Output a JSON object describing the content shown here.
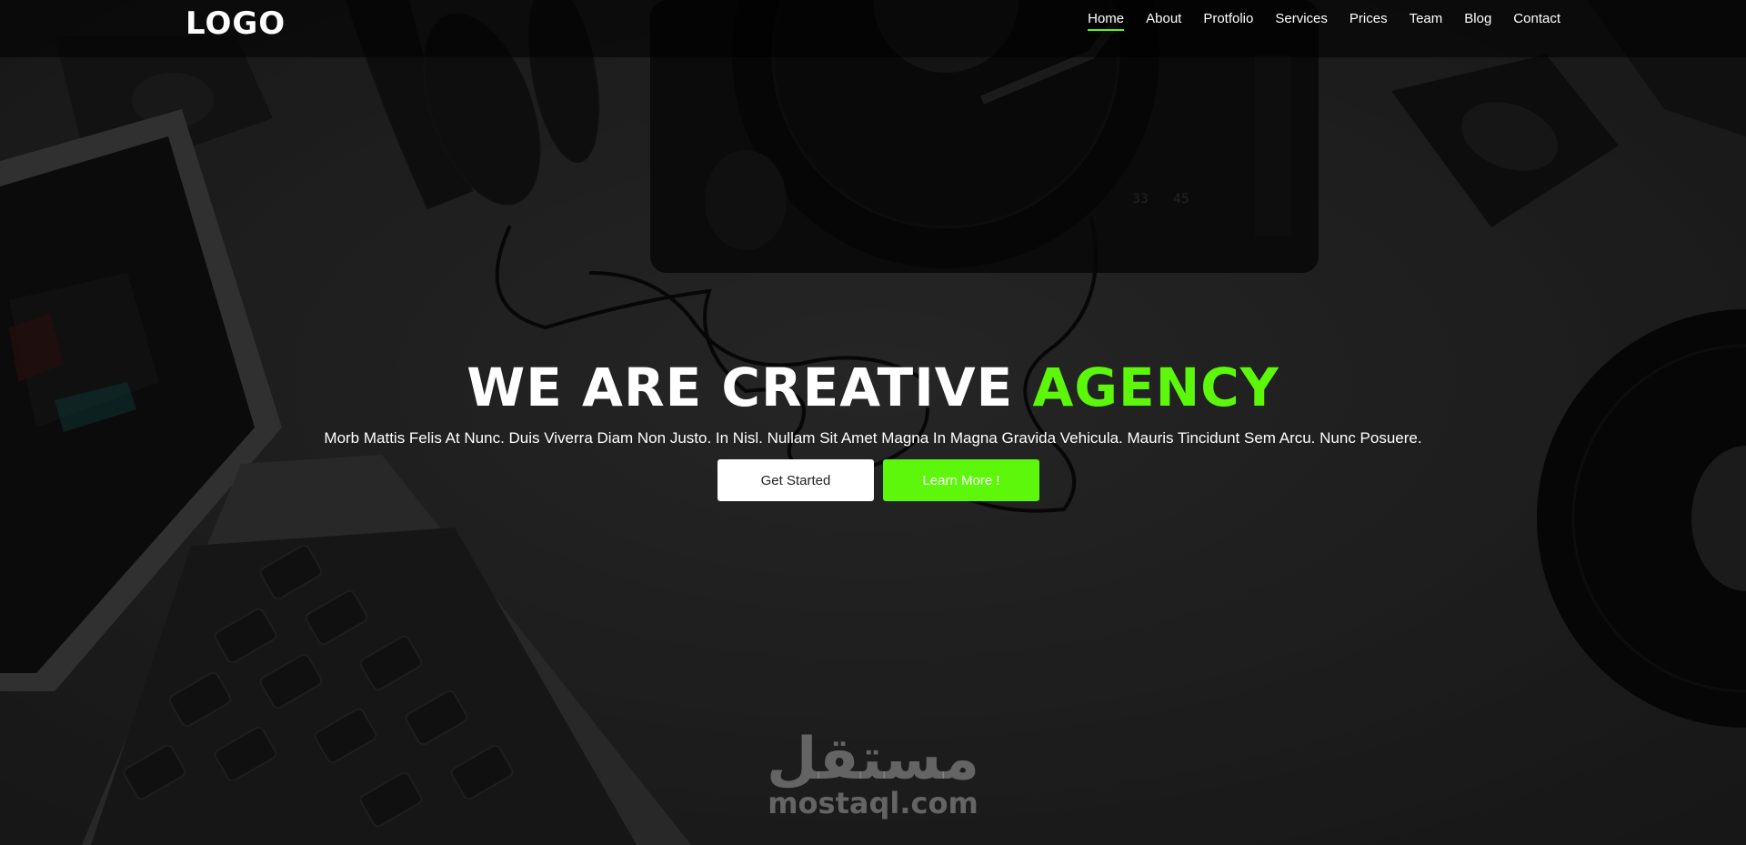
{
  "brand": {
    "logo_text": "LOGO"
  },
  "nav": {
    "items": [
      {
        "label": "Home",
        "active": true
      },
      {
        "label": "About",
        "active": false
      },
      {
        "label": "Protfolio",
        "active": false
      },
      {
        "label": "Services",
        "active": false
      },
      {
        "label": "Prices",
        "active": false
      },
      {
        "label": "Team",
        "active": false
      },
      {
        "label": "Blog",
        "active": false
      },
      {
        "label": "Contact",
        "active": false
      }
    ]
  },
  "hero": {
    "title_main": "WE ARE CREATIVE ",
    "title_accent": "AGENCY",
    "subtitle": "Morb Mattis Felis At Nunc. Duis Viverra Diam Non Justo. In Nisl. Nullam Sit Amet Magna In Magna Gravida Vehicula. Mauris Tincidunt Sem Arcu. Nunc Posuere.",
    "primary_button": "Get Started",
    "secondary_button": "Learn More !"
  },
  "background": {
    "turntable_speed_labels": [
      "33",
      "45"
    ]
  },
  "watermark": {
    "arabic": "مستقل",
    "latin": "mostaql.com"
  },
  "colors": {
    "accent": "#5cf70a",
    "nav_bg": "#000000",
    "button_white": "#ffffff"
  }
}
